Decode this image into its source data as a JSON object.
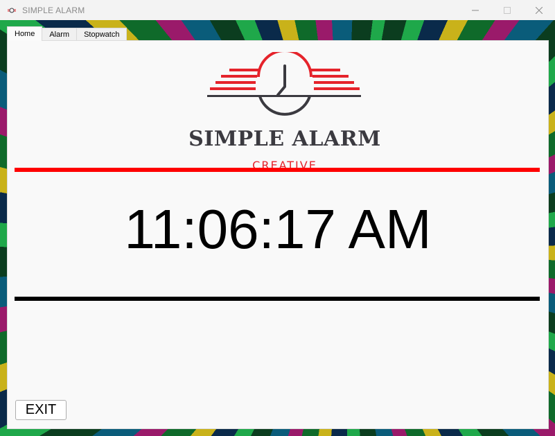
{
  "window": {
    "title": "SIMPLE ALARM",
    "app_icon": "alarm-logo-icon",
    "controls": [
      "minimize-icon",
      "maximize-icon",
      "close-icon"
    ]
  },
  "tabs": [
    {
      "label": "Home",
      "active": true
    },
    {
      "label": "Alarm",
      "active": false
    },
    {
      "label": "Stopwatch",
      "active": false
    }
  ],
  "home": {
    "logo": {
      "title": "SIMPLE ALARM",
      "subtitle": "CREATIVE",
      "accent_color": "#e5232b",
      "text_color": "#3b3a40"
    },
    "time": "11:06:17 AM",
    "exit_label": "EXIT",
    "divider_top_color": "#ff0000",
    "divider_bottom_color": "#000000"
  }
}
